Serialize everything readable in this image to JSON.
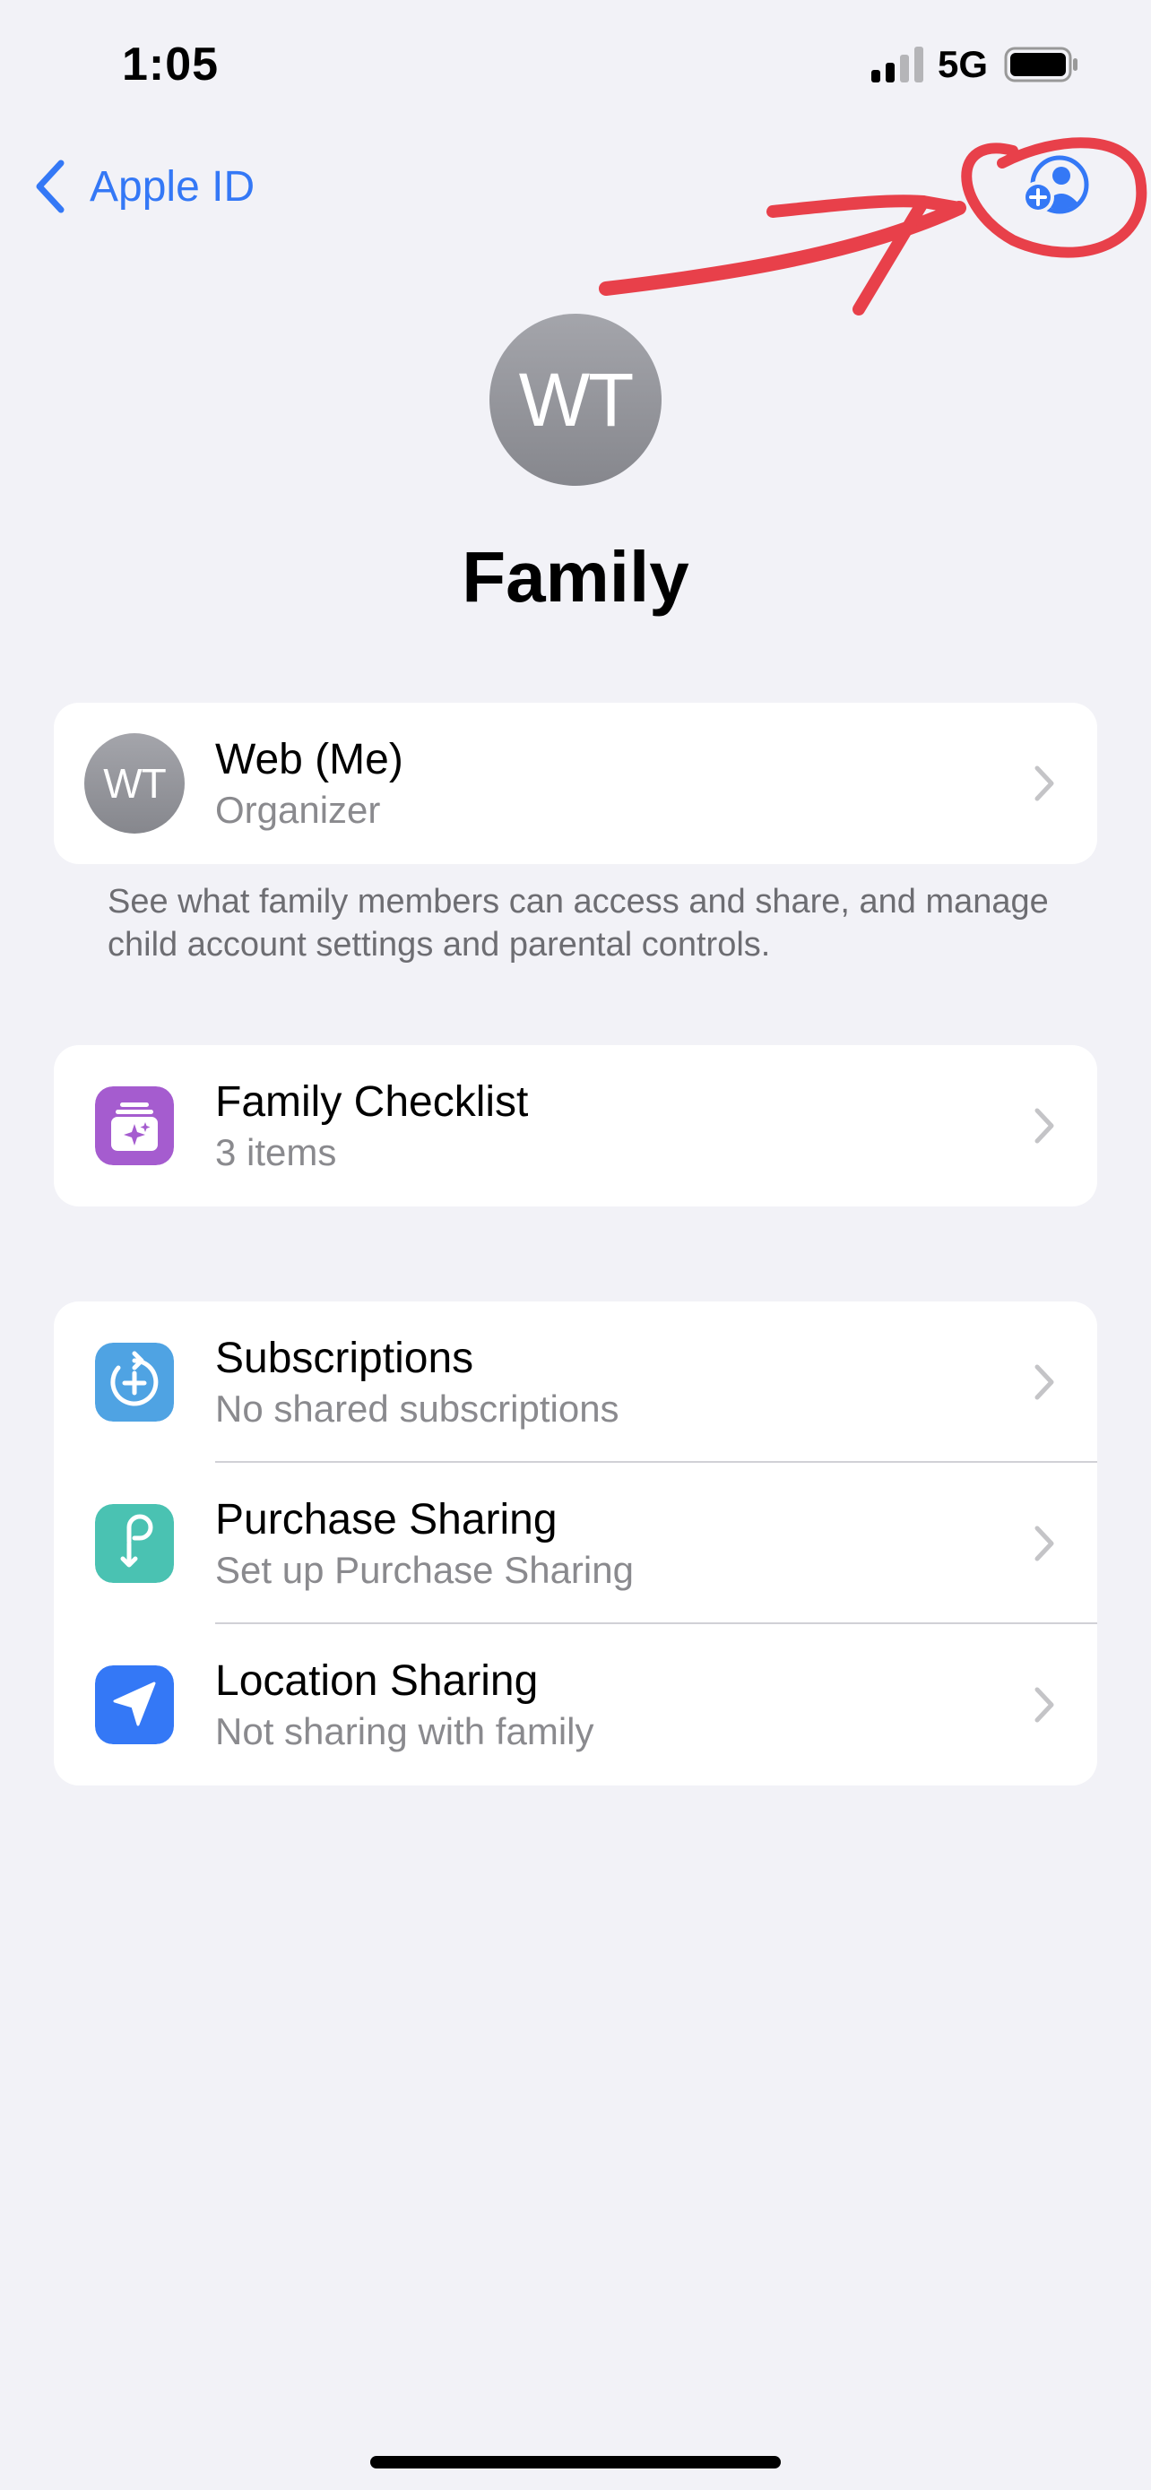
{
  "status_bar": {
    "time": "1:05",
    "network": "5G",
    "signal_icon": "cellular-signal-icon",
    "battery_icon": "battery-icon"
  },
  "nav": {
    "back_label": "Apple ID",
    "back_icon": "chevron-left-icon",
    "add_member_icon": "person-add-icon",
    "annotation_color": "#e8404a"
  },
  "header": {
    "avatar_initials": "WT",
    "title": "Family"
  },
  "organizer": {
    "initials": "WT",
    "name": "Web (Me)",
    "role": "Organizer",
    "note": "See what family members can access and share, and manage child account settings and parental controls."
  },
  "checklist": {
    "title": "Family Checklist",
    "subtitle": "3 items",
    "icon": "checklist-icon",
    "icon_color": "#a55ccf"
  },
  "sharing": [
    {
      "title": "Subscriptions",
      "subtitle": "No shared subscriptions",
      "icon": "subscriptions-icon",
      "icon_color": "#4fa3e3"
    },
    {
      "title": "Purchase Sharing",
      "subtitle": "Set up Purchase Sharing",
      "icon": "purchase-sharing-icon",
      "icon_color": "#4ac2b2"
    },
    {
      "title": "Location Sharing",
      "subtitle": "Not sharing with family",
      "icon": "location-arrow-icon",
      "icon_color": "#3478f6"
    }
  ],
  "colors": {
    "accent": "#3478f6",
    "background": "#f2f2f7",
    "secondary_text": "#8a8a8e"
  }
}
